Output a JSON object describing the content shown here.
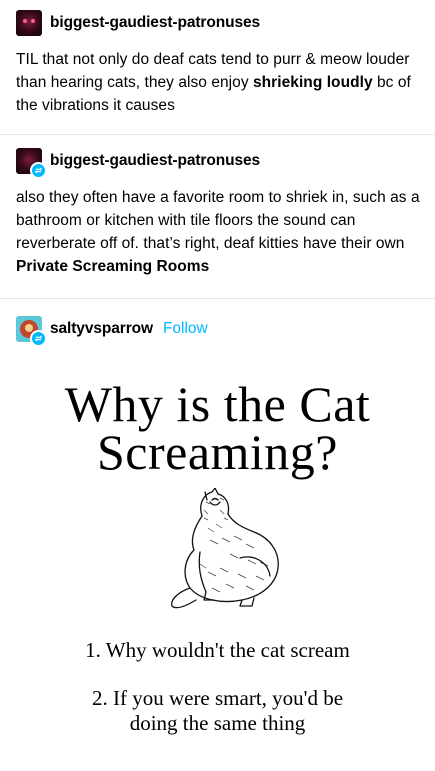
{
  "posts": [
    {
      "username": "biggest-gaudiest-patronuses",
      "text_parts": [
        {
          "t": "TIL that not only do deaf cats tend to purr & meow louder than hearing cats, they also enjoy ",
          "b": false
        },
        {
          "t": "shrieking loudly",
          "b": true
        },
        {
          "t": " bc of the vibrations it causes",
          "b": false
        }
      ]
    },
    {
      "username": "biggest-gaudiest-patronuses",
      "text_parts": [
        {
          "t": "also they often have a favorite room to shriek in, such as a bathroom or kitchen with tile floors the sound can reverberate off of. that’s right, deaf kitties have their own ",
          "b": false
        },
        {
          "t": "Private Screaming Rooms",
          "b": true
        }
      ]
    },
    {
      "username": "saltyvsparrow",
      "follow_label": "Follow"
    }
  ],
  "meme": {
    "title_line1": "Why is the Cat",
    "title_line2": "Screaming?",
    "item1": "1. Why wouldn't the cat scream",
    "item2_line1": "2. If you were smart, you'd be",
    "item2_line2": "doing the same thing"
  },
  "colors": {
    "accent": "#00b8ff",
    "divider": "#e6e6e6"
  }
}
